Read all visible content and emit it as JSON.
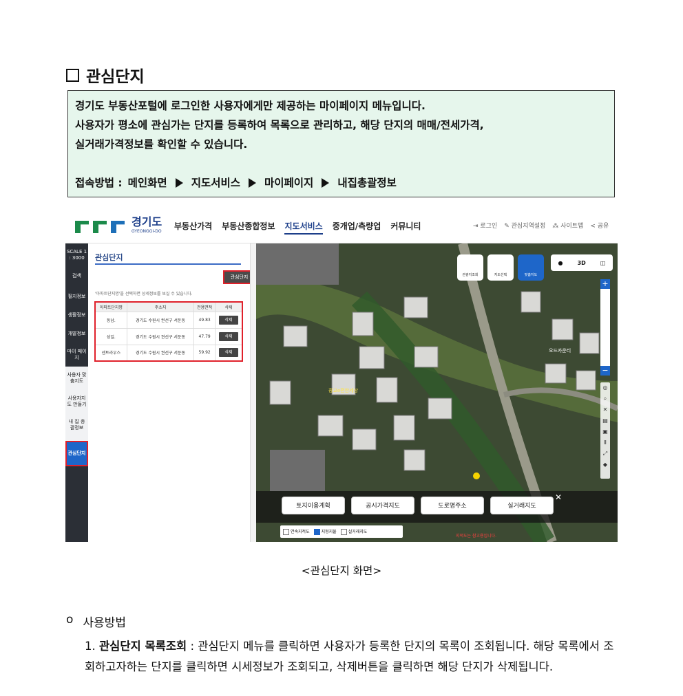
{
  "section": {
    "title": "관심단지"
  },
  "info": {
    "lines": [
      "경기도 부동산포털에 로그인한 사용자에게만 제공하는 마이페이지 메뉴입니다.",
      "사용자가 평소에 관심가는 단지를 등록하여 목록으로 관리하고, 해당 단지의 매매/전세가격,",
      "실거래가격정보를 확인할 수 있습니다."
    ],
    "path_label": "접속방법 :",
    "path": [
      "메인화면",
      "지도서비스",
      "마이페이지",
      "내집총괄정보"
    ]
  },
  "screenshot": {
    "logo": {
      "name": "경기도",
      "sub": "GYEONGGI-DO"
    },
    "nav": [
      "부동산가격",
      "부동산종합정보",
      "지도서비스",
      "중개업/측량업",
      "커뮤니티"
    ],
    "util": [
      "로그인",
      "관심지역설정",
      "사이트맵",
      "공유"
    ],
    "sidebar": [
      "SCALE 1 : 3000",
      "검색",
      "필지정보",
      "생활정보",
      "개발정보",
      "마이 페이지",
      "사용자 맞춤지도",
      "사용자지도 만들기",
      "내 집 총괄정보",
      "관심단지"
    ],
    "panel": {
      "title": "관심단지",
      "register_button": "관심단지 등록",
      "note": "'아파트단지명'을 선택하면 상세정보를 보실 수 있습니다.",
      "table": {
        "headers": [
          "아파트단지명",
          "주소지",
          "전용면적",
          "삭제"
        ],
        "rows": [
          {
            "name": "동남.",
            "addr": "경기도 수원시 권선구 서둔동",
            "area": "49.83",
            "del": "삭제"
          },
          {
            "name": "성일.",
            "addr": "경기도 수원시 권선구 서둔동",
            "area": "47.79",
            "del": "삭제"
          },
          {
            "name": "센트라우스",
            "addr": "경기도 수원시 권선구 서둔동",
            "area": "59.92",
            "del": "삭제"
          }
        ]
      }
    },
    "map": {
      "controls": [
        "관광지조회",
        "지도선택",
        "맞춤지도"
      ],
      "view_buttons": [
        "3D"
      ],
      "bottom_buttons": [
        "토지이용계획",
        "공시가격지도",
        "도로명주소",
        "실거래지도"
      ],
      "checks": [
        {
          "label": "연속지적도",
          "checked": false
        },
        {
          "label": "지형지물",
          "checked": true
        },
        {
          "label": "실거래지도",
          "checked": false
        }
      ],
      "labels": [
        "오드카운티",
        "광교e편한세상"
      ],
      "warning": "지적도는 참고용입니다."
    }
  },
  "caption": "<관심단지 화면>",
  "usage": {
    "bullet": "o",
    "title": "사용방법"
  },
  "steps": [
    {
      "num": "1.",
      "title": "관심단지 목록조회",
      "text": ": 관심단지 메뉴를 클릭하면 사용자가 등록한 단지의 목록이 조회됩니다. 해당 목록에서 조회하고자하는 단지를 클릭하면 시세정보가 조회되고, 삭제버튼을 클릭하면 해당 단지가 삭제됩니다."
    }
  ]
}
